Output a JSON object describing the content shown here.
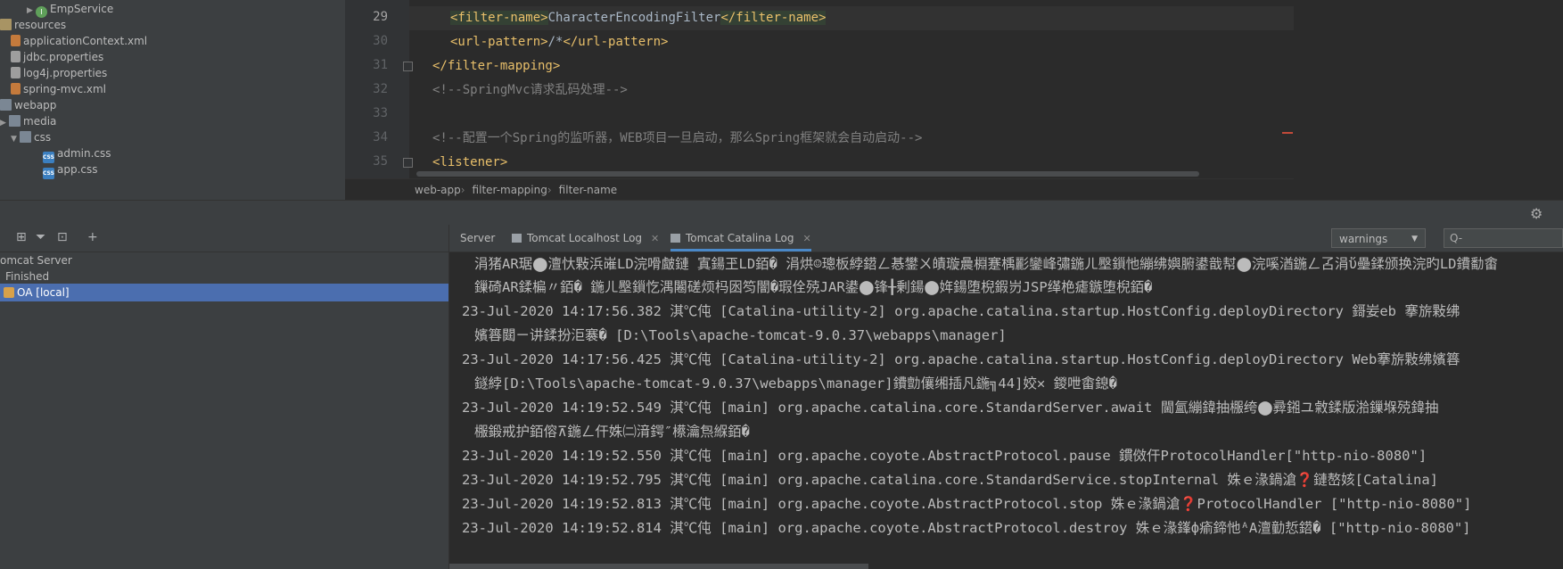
{
  "project_tree": {
    "items": [
      {
        "label": "EmpService",
        "icon": "service-icon"
      },
      {
        "label": "resources",
        "icon": "folder-icon"
      },
      {
        "label": "applicationContext.xml",
        "icon": "xml-file-icon"
      },
      {
        "label": "jdbc.properties",
        "icon": "properties-file-icon"
      },
      {
        "label": "log4j.properties",
        "icon": "properties-file-icon"
      },
      {
        "label": "spring-mvc.xml",
        "icon": "xml-file-icon"
      },
      {
        "label": "webapp",
        "icon": "folder-icon"
      },
      {
        "label": "media",
        "icon": "folder-icon"
      },
      {
        "label": "css",
        "icon": "folder-icon"
      },
      {
        "label": "admin.css",
        "icon": "css-file-icon"
      },
      {
        "label": "app.css",
        "icon": "css-file-icon"
      }
    ]
  },
  "editor": {
    "line_numbers": [
      "29",
      "30",
      "31",
      "32",
      "33",
      "34",
      "35"
    ],
    "lines": [
      {
        "open": "<filter-name>",
        "text": "CharacterEncodingFilter",
        "close": "</filter-name>"
      },
      {
        "open": "<url-pattern>",
        "text": "/*",
        "close": "</url-pattern>"
      },
      {
        "open": "</filter-mapping>",
        "text": "",
        "close": ""
      },
      {
        "comment": "<!--SpringMvc请求乱码处理-->"
      },
      {
        "comment": ""
      },
      {
        "comment": "<!--配置一个Spring的监听器，WEB项目一旦启动，那么Spring框架就会自动启动-->"
      },
      {
        "open": "<listener>",
        "text": "",
        "close": ""
      }
    ],
    "breadcrumb": [
      "web-app",
      "filter-mapping",
      "filter-name"
    ]
  },
  "services": {
    "tree": [
      {
        "label": "omcat Server"
      },
      {
        "label": "Finished"
      },
      {
        "label": "OA [local]"
      }
    ],
    "tabs": [
      {
        "label": "Server"
      },
      {
        "label": "Tomcat Localhost Log"
      },
      {
        "label": "Tomcat Catalina Log"
      }
    ],
    "log_level": "warnings",
    "search_placeholder": "Q-",
    "log_lines": [
      "涓猪AR琚⬤澶忕敤浜嶉LD浣嗗皻鏈  寘鍚玊LD銆� 涓烘☺璁板綍鍣ㄥ惎鐢ㄨ皟璇曟棩蹇楀彲鑾峰彇鍦ㄦ壂鎻忚繃绋嬩腑鍙戠幇⬤浣嗘湭鍦ㄥ叾涓ὔ壘鍒颁换浣旳LD鐨勫畬",
      "鏁碕AR鍒楄〃銆� 鍦ㄦ壂鎻忔湡闂磋烦杩囦笉闇�瑕佺殑JAR鍙⬤锋╂剰鍚⬤姩鍚堕棿鍜岃JSP缂栬瘧鏃堕棿銆�",
      "23-Jul-2020 14:17:56.382 淇℃伅 [Catalina-utility-2] org.apache.catalina.startup.HostConfig.deployDirectory 鎶妛eb 搴旂敤绋",
      "嬪簭閮ㄧ讲鍒扮洰褰� [D:\\Tools\\apache-tomcat-9.0.37\\webapps\\manager]",
      "23-Jul-2020 14:17:56.425 淇℃伅 [Catalina-utility-2] org.apache.catalina.startup.HostConfig.deployDirectory Web搴旂敤绋嬪簭",
      "鐩綍[D:\\Tools\\apache-tomcat-9.0.37\\webapps\\manager]鐨勯儴缃插凡鍦╗44]姣✕  鍐呭畬鎴�",
      "23-Jul-2020 14:19:52.549 淇℃伅 [main] org.apache.catalina.core.StandardServer.await 閫氳繃鍏抽棴绔⬤彛鎺ユ敹鍒版湁鏁堢殑鍏抽",
      "棴鍛戒护銆傛⊼鍦ㄥ仠姝㈡湇鍔″櫒瀹炰緥銆�",
      "23-Jul-2020 14:19:52.550 淇℃伅 [main] org.apache.coyote.AbstractProtocol.pause 鏆傚仠ProtocolHandler[\"http-nio-8080\"]",
      "23-Jul-2020 14:19:52.795 淇℃伅 [main] org.apache.catalina.core.StandardService.stopInternal 姝ｅ湪鍋滄❓鏈嶅姟[Catalina]",
      "23-Jul-2020 14:19:52.813 淇℃伅 [main] org.apache.coyote.AbstractProtocol.stop 姝ｅ湪鍋滄❓ProtocolHandler [\"http-nio-8080\"]",
      "23-Jul-2020 14:19:52.814 淇℃伅 [main] org.apache.coyote.AbstractProtocol.destroy 姝ｅ湪鎽ф瘉鍗忚ᴬA澶勭悊鍣� [\"http-nio-8080\"]"
    ]
  }
}
